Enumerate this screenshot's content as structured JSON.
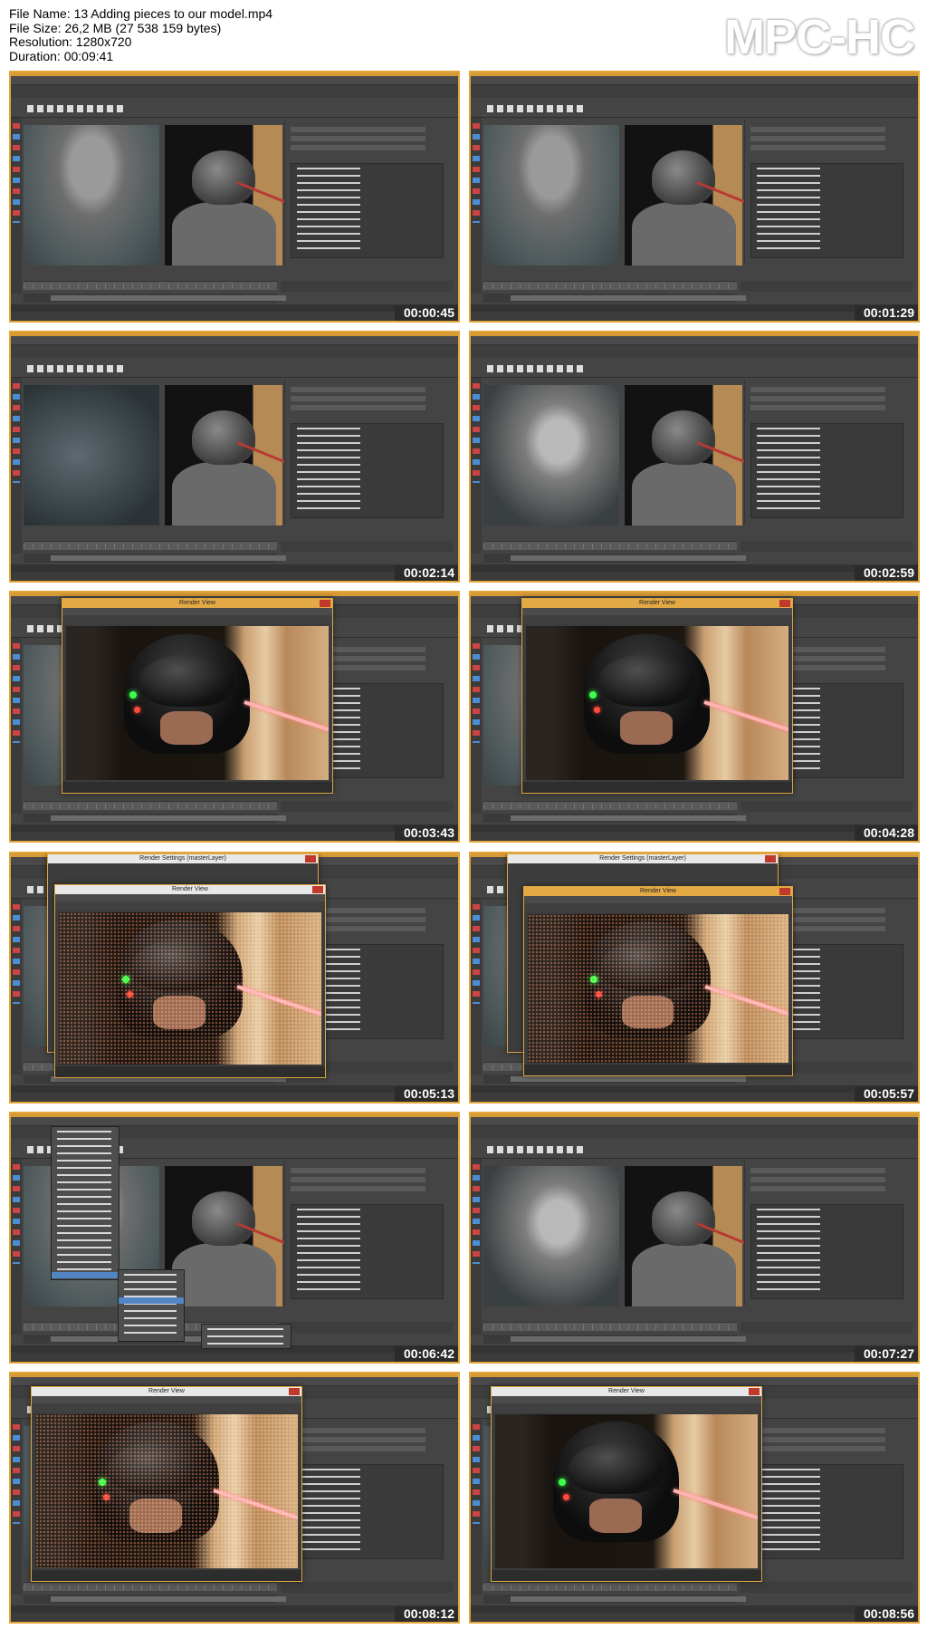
{
  "info": {
    "file_name": "File Name: 13 Adding pieces to our model.mp4",
    "file_size": "File Size: 26,2 MB (27 538 159 bytes)",
    "resolution": "Resolution: 1280x720",
    "duration": "Duration: 00:09:41"
  },
  "logo": "MPC-HC",
  "colors": {
    "frame_border": "#e1a53a",
    "maya_ui": "#444444",
    "timestamp_bg": "#2b2b2b",
    "render_window_title": "#e3a945"
  },
  "thumbnails": [
    {
      "timestamp": "00:00:45",
      "scene": "viewport"
    },
    {
      "timestamp": "00:01:29",
      "scene": "viewport"
    },
    {
      "timestamp": "00:02:14",
      "scene": "viewport-dark"
    },
    {
      "timestamp": "00:02:59",
      "scene": "viewport-head"
    },
    {
      "timestamp": "00:03:43",
      "scene": "render-view",
      "render_title": "Render View"
    },
    {
      "timestamp": "00:04:28",
      "scene": "render-view",
      "render_title": "Render View"
    },
    {
      "timestamp": "00:05:13",
      "scene": "render-settings",
      "render_title": "Render View",
      "settings_title": "Render Settings (masterLayer)"
    },
    {
      "timestamp": "00:05:57",
      "scene": "render-settings",
      "render_title": "Render View",
      "settings_title": "Render Settings (masterLayer)"
    },
    {
      "timestamp": "00:06:42",
      "scene": "menu"
    },
    {
      "timestamp": "00:07:27",
      "scene": "viewport-head"
    },
    {
      "timestamp": "00:08:12",
      "scene": "render-view-grey",
      "render_title": "Render View"
    },
    {
      "timestamp": "00:08:56",
      "scene": "render-view-grey",
      "render_title": "Render View"
    }
  ]
}
